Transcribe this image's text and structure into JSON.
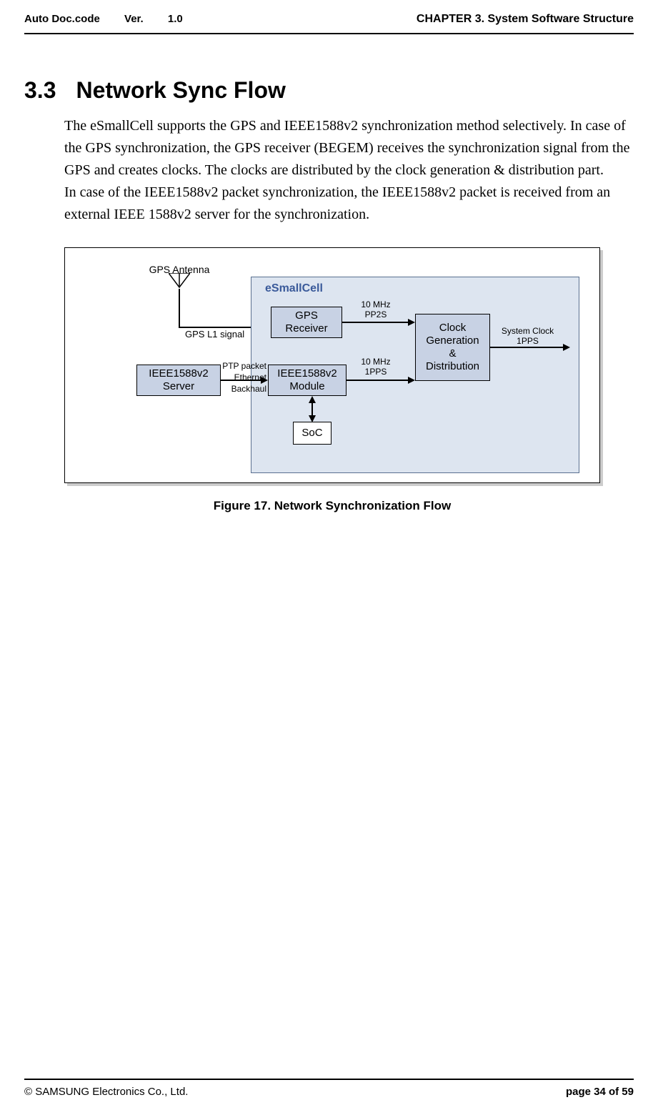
{
  "header": {
    "doc_code_label": "Auto Doc.code",
    "ver_label": "Ver.",
    "ver_value": "1.0",
    "chapter": "CHAPTER 3. System Software Structure"
  },
  "section": {
    "number": "3.3",
    "title": "Network Sync Flow"
  },
  "body": "The eSmallCell supports the GPS and IEEE1588v2 synchronization method selectively. In case of the GPS synchronization, the GPS receiver (BEGEM) receives the synchronization signal from the GPS and creates clocks. The clocks are distributed by the clock generation & distribution part.",
  "body2": "In case of the IEEE1588v2 packet synchronization, the IEEE1588v2 packet is received from an external IEEE 1588v2 server for the synchronization.",
  "diagram": {
    "antenna_label": "GPS Antenna",
    "inner_title": "eSmallCell",
    "gps_l1": "GPS L1 signal",
    "ptp_lines": {
      "l1": "PTP packet",
      "l2": "Ethernet",
      "l3": "Backhaul"
    },
    "sig1": {
      "l1": "10 MHz",
      "l2": "PP2S"
    },
    "sig2": {
      "l1": "10 MHz",
      "l2": "1PPS"
    },
    "out": {
      "l1": "System Clock",
      "l2": "1PPS"
    },
    "nodes": {
      "server": {
        "l1": "IEEE1588v2",
        "l2": "Server"
      },
      "gps_rx": {
        "l1": "GPS",
        "l2": "Receiver"
      },
      "module": {
        "l1": "IEEE1588v2",
        "l2": "Module"
      },
      "clock": {
        "l1": "Clock",
        "l2": "Generation",
        "l3": "&",
        "l4": "Distribution"
      },
      "soc": "SoC"
    }
  },
  "figure_caption": "Figure 17. Network Synchronization Flow",
  "footer": {
    "copyright": "© SAMSUNG Electronics Co., Ltd.",
    "page": "page 34 of 59"
  }
}
